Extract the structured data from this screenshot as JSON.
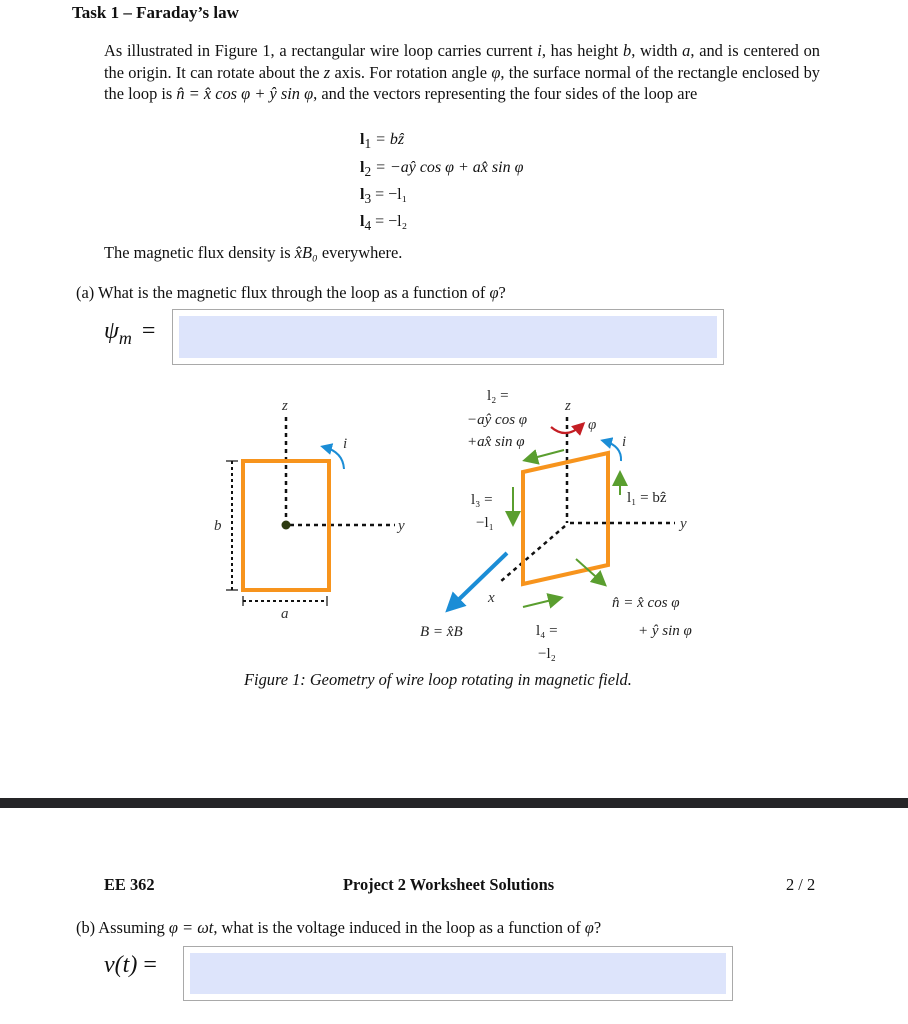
{
  "task": {
    "title": "Task 1 – Faraday’s law",
    "intro": {
      "p1": "As illustrated in Figure 1, a rectangular wire loop carries current ",
      "v_i": "i",
      "p2": ", has height ",
      "v_b": "b",
      "p3": ", width ",
      "v_a": "a",
      "p4": ", and is centered on the origin. It can rotate about the ",
      "v_z": "z",
      "p5": " axis. For rotation angle ",
      "v_phi": "φ",
      "p6": ", the surface normal of the rectangle enclosed by the loop is ",
      "normal_expr": "n̂ = x̂ cos φ + ŷ sin φ",
      "p7": ", and the vectors representing the four sides of the loop are"
    },
    "equations": [
      {
        "lhs": "l",
        "sub": "1",
        "rhs": "= bẑ"
      },
      {
        "lhs": "l",
        "sub": "2",
        "rhs": "= −aŷ cos φ + ax̂ sin φ"
      },
      {
        "lhs": "l",
        "sub": "3",
        "rhs": "= −l₁"
      },
      {
        "lhs": "l",
        "sub": "4",
        "rhs": "= −l₂"
      }
    ],
    "flux_statement": {
      "pre": "The magnetic flux density is ",
      "expr": "x̂B₀",
      "post": " everywhere."
    }
  },
  "part_a": {
    "question_pre": "(a) What is the magnetic flux through the loop as a function of ",
    "question_var": "φ",
    "question_post": "?",
    "answer_label": "ψ",
    "answer_label_sub": "m",
    "equals": "=",
    "answer_value": ""
  },
  "figure": {
    "left": {
      "z_label": "z",
      "y_label": "y",
      "i_label": "i",
      "b_label": "b",
      "a_label": "a"
    },
    "right": {
      "z_label": "z",
      "y_label": "y",
      "x_label": "x",
      "i_label": "i",
      "phi_label": "φ",
      "l2_line1": "l₂ =",
      "l2_line2": "−aŷ cos φ",
      "l2_line3": "+ax̂ sin φ",
      "l3_line1": "l₃ =",
      "l3_line2": "−l₁",
      "l1_label": "l₁ = bẑ",
      "n_line1": "n̂ = x̂ cos φ",
      "n_line2": "+ ŷ sin φ",
      "B_label": "B = x̂B",
      "l4_line1": "l₄ =",
      "l4_line2": "−l₂"
    },
    "caption": "Figure 1: Geometry of wire loop rotating in magnetic field.",
    "colors": {
      "loop": "#f7941d",
      "vector": "#5a9e2f",
      "current": "#1b8dd6",
      "rotation": "#c41e24",
      "B_field": "#1b8dd6",
      "origin": "#2c3a10"
    }
  },
  "footer": {
    "course": "EE 362",
    "title": "Project 2 Worksheet Solutions",
    "page": "2 / 2"
  },
  "part_b": {
    "question_pre": "(b) Assuming ",
    "question_expr": "φ = ωt",
    "question_mid": ", what is the voltage induced in the loop as a function of ",
    "question_var": "φ",
    "question_post": "?",
    "answer_label": "v(t)",
    "equals": "=",
    "answer_value": ""
  },
  "colors": {
    "answer_fill": "#dde4fb",
    "page_separator": "#252527"
  }
}
